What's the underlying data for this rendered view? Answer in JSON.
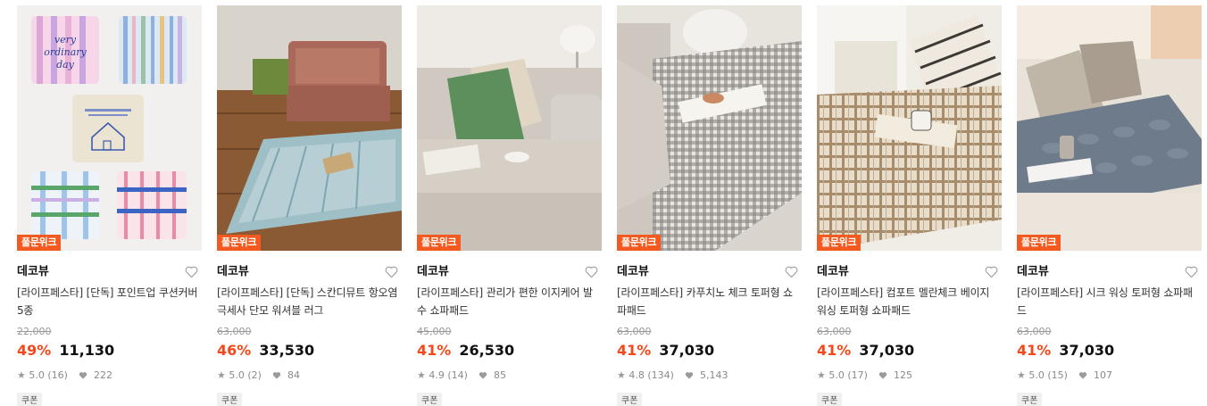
{
  "products": [
    {
      "badge": "풀문위크",
      "brand": "데코뷰",
      "title": "[라이프페스타] [단독] 포인트업 쿠션커버 5종",
      "original_price": "22,000",
      "discount": "49%",
      "price": "11,130",
      "rating": "5.0",
      "reviews": "(16)",
      "likes": "222",
      "coupon": "쿠폰",
      "image_text_1": "very ordinary day"
    },
    {
      "badge": "풀문위크",
      "brand": "데코뷰",
      "title": "[라이프페스타] [단독] 스칸디뮤트 항오염 극세사 단모 워셔블 러그",
      "original_price": "63,000",
      "discount": "46%",
      "price": "33,530",
      "rating": "5.0",
      "reviews": "(2)",
      "likes": "84",
      "coupon": "쿠폰"
    },
    {
      "badge": "풀문위크",
      "brand": "데코뷰",
      "title": "[라이프페스타] 관리가 편한 이지케어 발수 쇼파패드",
      "original_price": "45,000",
      "discount": "41%",
      "price": "26,530",
      "rating": "4.9",
      "reviews": "(14)",
      "likes": "85",
      "coupon": "쿠폰"
    },
    {
      "badge": "풀문위크",
      "brand": "데코뷰",
      "title": "[라이프페스타] 카푸치노 체크 토퍼형 쇼파패드",
      "original_price": "63,000",
      "discount": "41%",
      "price": "37,030",
      "rating": "4.8",
      "reviews": "(134)",
      "likes": "5,143",
      "coupon": "쿠폰"
    },
    {
      "badge": "풀문위크",
      "brand": "데코뷰",
      "title": "[라이프페스타] 컴포트 멜란체크 베이지 워싱 토퍼형 쇼파패드",
      "original_price": "63,000",
      "discount": "41%",
      "price": "37,030",
      "rating": "5.0",
      "reviews": "(17)",
      "likes": "125",
      "coupon": "쿠폰"
    },
    {
      "badge": "풀문위크",
      "brand": "데코뷰",
      "title": "[라이프페스타] 시크 워싱 토퍼형 쇼파패드",
      "original_price": "63,000",
      "discount": "41%",
      "price": "37,030",
      "rating": "5.0",
      "reviews": "(15)",
      "likes": "107",
      "coupon": "쿠폰"
    }
  ],
  "colors": {
    "badge": "#f25a1f",
    "discount": "#f2481b",
    "muted": "#8a8a8a"
  },
  "icons": {
    "wishlist": "heart-outline-icon",
    "rating": "star-icon",
    "likes": "heart-filled-icon"
  }
}
